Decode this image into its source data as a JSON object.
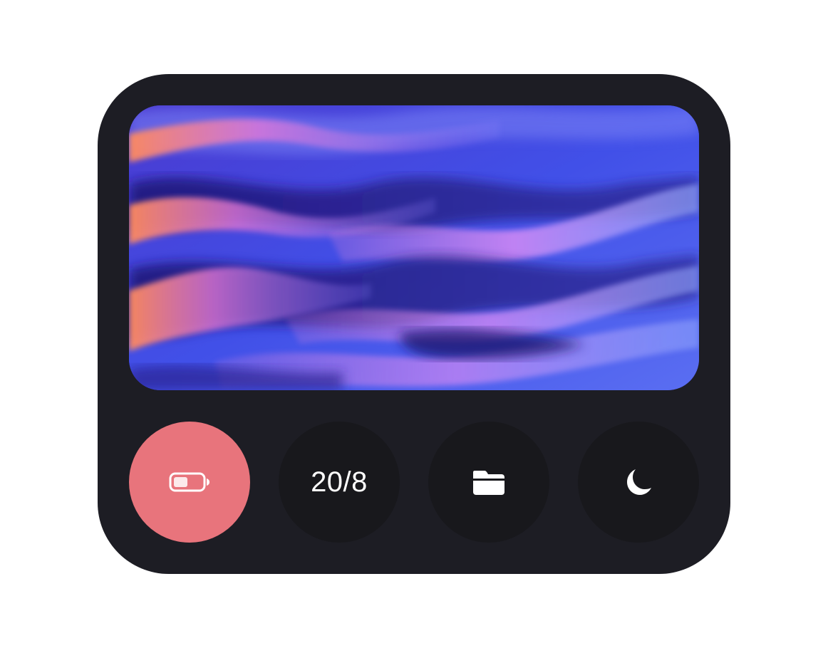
{
  "widget": {
    "date_label": "20/8",
    "battery": {
      "level": 0.4,
      "accent_color": "#e8747c",
      "icon": "battery-low-icon"
    },
    "buttons": [
      {
        "id": "battery",
        "icon": "battery-low-icon"
      },
      {
        "id": "date",
        "label": "20/8"
      },
      {
        "id": "files",
        "icon": "folder-icon"
      },
      {
        "id": "dark-mode",
        "icon": "moon-icon"
      }
    ],
    "colors": {
      "widget_bg": "#1d1d24",
      "button_bg": "#18181c",
      "icon_color": "#ffffff"
    },
    "wallpaper": {
      "description": "",
      "palette": [
        "#3a3fd8",
        "#6a5cf0",
        "#b77cf5",
        "#ff8a6e",
        "#1f1a6b"
      ]
    }
  }
}
